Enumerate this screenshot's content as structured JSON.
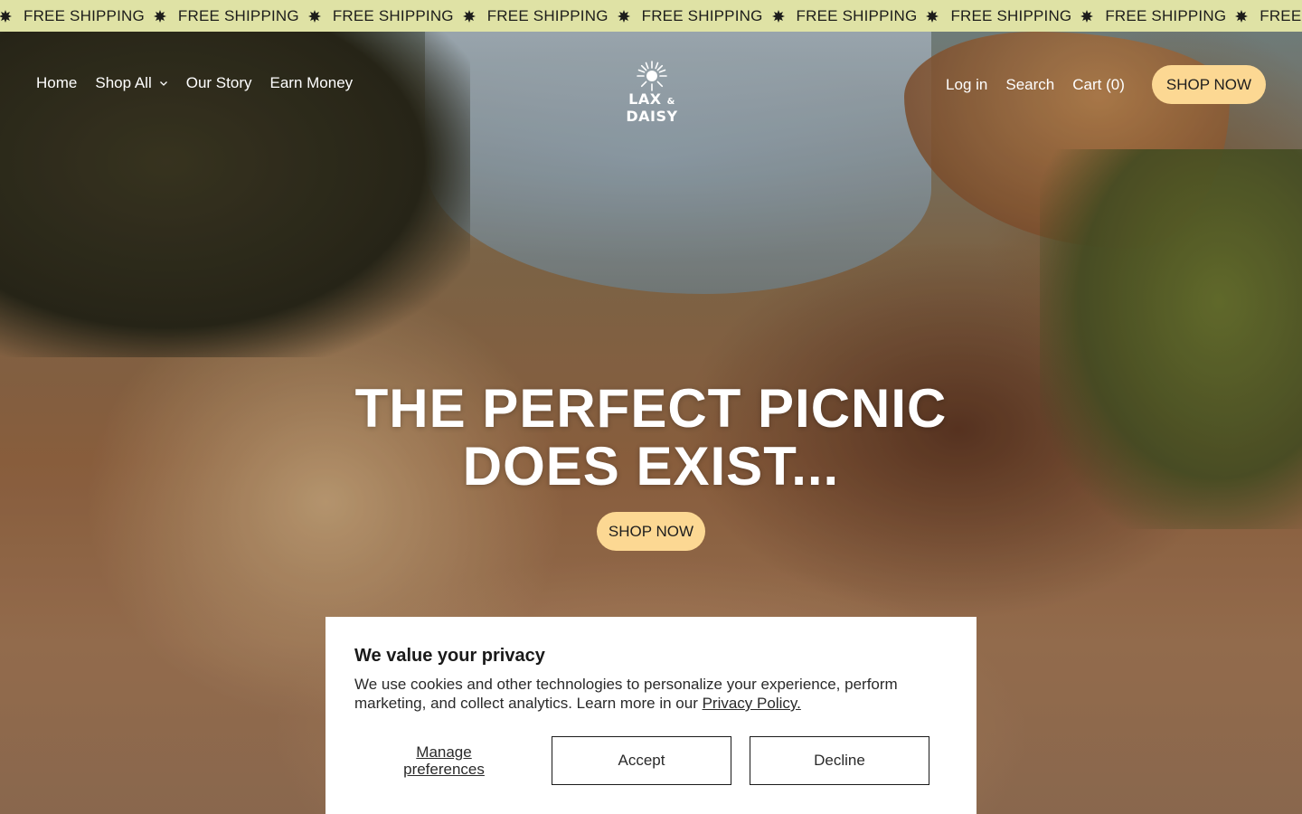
{
  "announcement": {
    "items": [
      "FREE SHIPPING",
      "FREE SHIPPING",
      "FREE SHIPPING",
      "FREE SHIPPING",
      "FREE SHIPPING",
      "FREE SHIPPING",
      "FREE SHIPPING",
      "FREE SHIPPING",
      "FREE SHIPPING",
      "FREE SHIPPING"
    ],
    "separator_icon": "sun-burst-icon",
    "background": "#dfe2a5"
  },
  "header": {
    "nav_left": [
      {
        "label": "Home"
      },
      {
        "label": "Shop All",
        "icon": "chevron-down-icon"
      },
      {
        "label": "Our Story"
      },
      {
        "label": "Earn Money"
      }
    ],
    "logo": {
      "text_main": "LAX",
      "text_amp": "&",
      "text_end": "DAISY",
      "icon": "sun-icon"
    },
    "nav_right": {
      "login": "Log in",
      "search": "Search",
      "cart": "Cart (0)",
      "shop_now": "SHOP NOW"
    }
  },
  "hero": {
    "headline_line1": "THE PERFECT PICNIC",
    "headline_line2": "DOES EXIST...",
    "cta": "SHOP NOW",
    "accent": "#fcd893"
  },
  "cookie_banner": {
    "title": "We value your privacy",
    "body": "We use cookies and other technologies to personalize your experience, perform marketing, and collect analytics. Learn more in our ",
    "link": "Privacy Policy.",
    "manage_line1": "Manage",
    "manage_line2": "preferences",
    "accept": "Accept",
    "decline": "Decline"
  }
}
